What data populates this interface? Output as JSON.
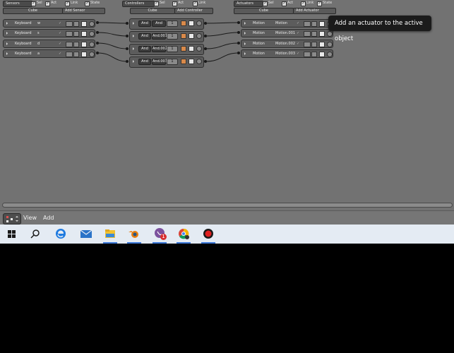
{
  "sensors": {
    "header_dropdown": "Sensors",
    "sel_label": "Sel",
    "act_label": "Act",
    "link_label": "Link",
    "state_label": "State",
    "object_name": "Cube",
    "add_button": "Add Sensor",
    "items": [
      {
        "type": "Keyboard",
        "key": "w"
      },
      {
        "type": "Keyboard",
        "key": "s"
      },
      {
        "type": "Keyboard",
        "key": "d"
      },
      {
        "type": "Keyboard",
        "key": "a"
      }
    ]
  },
  "controllers": {
    "header_dropdown": "Controllers",
    "sel_label": "Sel",
    "act_label": "Act",
    "link_label": "Link",
    "object_name": "Cube",
    "add_button": "Add Controller",
    "items": [
      {
        "type": "And",
        "name": "And",
        "state": "1"
      },
      {
        "type": "And",
        "name": "And.001",
        "state": "1"
      },
      {
        "type": "And",
        "name": "And.002",
        "state": "1"
      },
      {
        "type": "And",
        "name": "And.003",
        "state": "1"
      }
    ]
  },
  "actuators": {
    "header_dropdown": "Actuators",
    "sel_label": "Sel",
    "act_label": "Act",
    "link_label": "Link",
    "state_label": "State",
    "object_name": "Cube",
    "add_button": "Add Actuator",
    "items": [
      {
        "type": "Motion",
        "name": "Motion"
      },
      {
        "type": "Motion",
        "name": "Motion.001"
      },
      {
        "type": "Motion",
        "name": "Motion.002"
      },
      {
        "type": "Motion",
        "name": "Motion.003"
      }
    ]
  },
  "tooltip": "Add an actuator to the active object",
  "footer": {
    "view_menu": "View",
    "add_menu": "Add"
  },
  "taskbar": {
    "icons": [
      "windows-start-icon",
      "search-icon",
      "edge-browser-icon",
      "mail-icon",
      "file-explorer-icon",
      "blender-icon",
      "viber-icon",
      "chrome-icon",
      "record-icon"
    ],
    "viber_badge": "1"
  },
  "colors": {
    "editor_bg": "#727272",
    "taskbar_bg": "#e4ebf3",
    "accent": "#3b78d8"
  }
}
